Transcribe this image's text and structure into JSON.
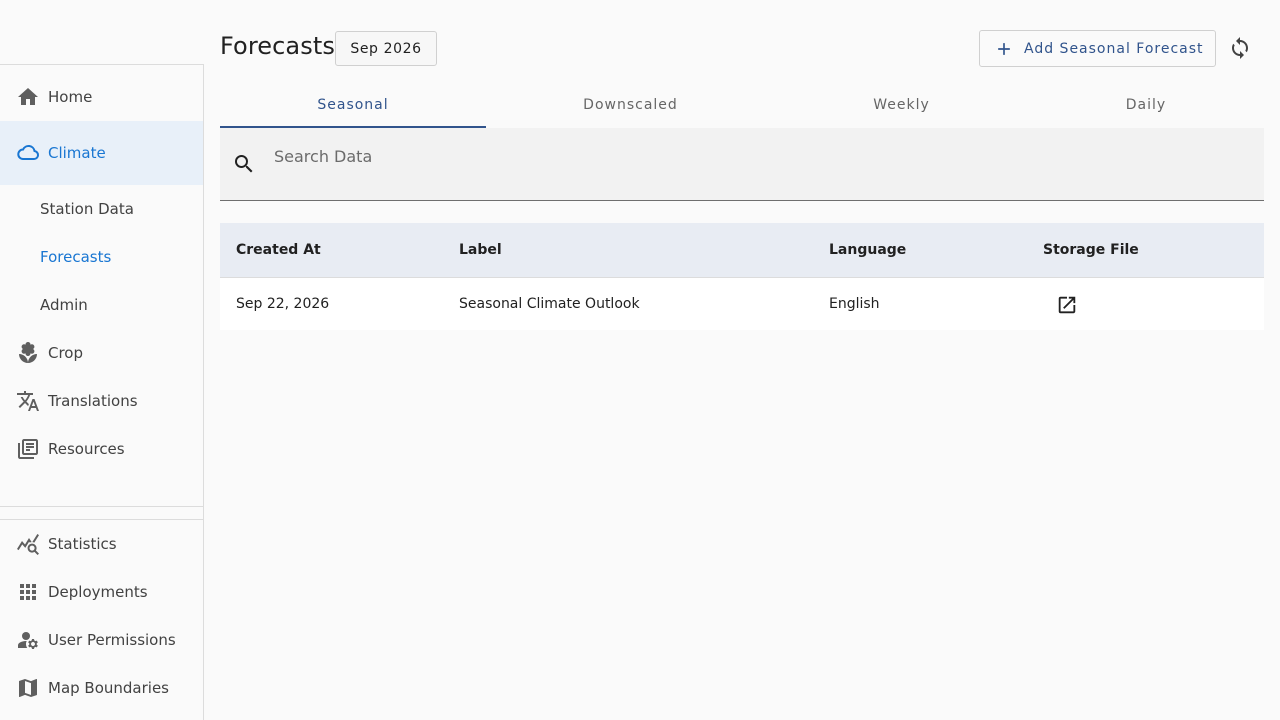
{
  "header": {
    "title": "Forecasts",
    "date_chip": "Sep 2026",
    "add_button_label": "Add Seasonal Forecast"
  },
  "sidebar": {
    "home": "Home",
    "climate": "Climate",
    "climate_sub": [
      "Station Data",
      "Forecasts",
      "Admin"
    ],
    "crop": "Crop",
    "translations": "Translations",
    "resources": "Resources",
    "statistics": "Statistics",
    "deployments": "Deployments",
    "user_permissions": "User Permissions",
    "map_boundaries": "Map Boundaries"
  },
  "tabs": [
    "Seasonal",
    "Downscaled",
    "Weekly",
    "Daily"
  ],
  "search": {
    "placeholder": "Search Data",
    "value": ""
  },
  "table": {
    "columns": [
      "Created At",
      "Label",
      "Language",
      "Storage File"
    ],
    "rows": [
      {
        "created_at": "Sep 22, 2026",
        "label": "Seasonal Climate Outlook",
        "language": "English"
      }
    ]
  },
  "colors": {
    "accent": "#1976d2",
    "tab_accent": "#31548c",
    "table_header_bg": "#e8ecf3"
  }
}
